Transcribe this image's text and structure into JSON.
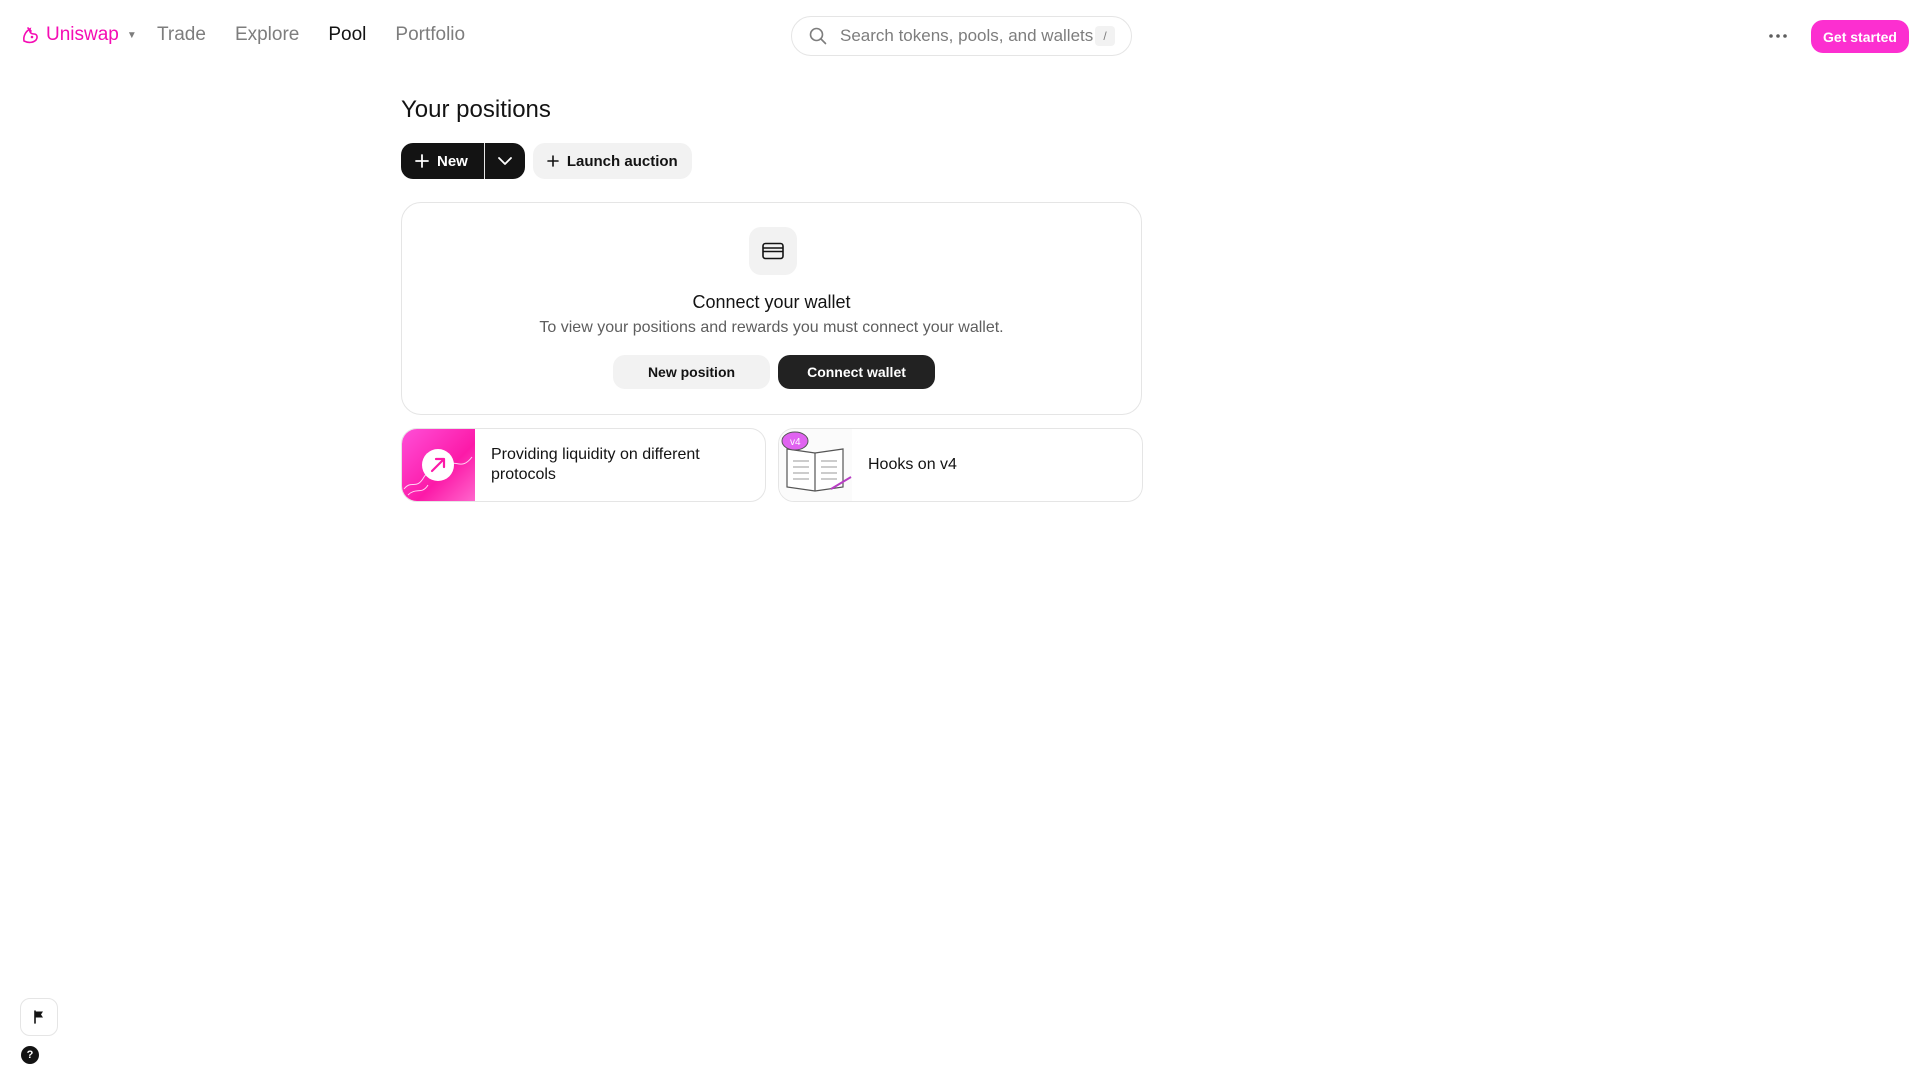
{
  "nav": {
    "brand": "Uniswap",
    "brand_icon": "uniswap-unicorn-icon",
    "links": [
      "Trade",
      "Explore",
      "Pool",
      "Portfolio"
    ],
    "active_link": "Pool",
    "search_placeholder": "Search tokens, pools, and wallets",
    "search_shortcut": "/",
    "more_icon": "more-horizontal-icon",
    "get_started_label": "Get started"
  },
  "main": {
    "title": "Your positions",
    "new_label": "New",
    "launch_auction_label": "Launch auction",
    "wallet_card": {
      "icon": "wallet-icon",
      "title": "Connect your wallet",
      "description": "To view your positions and rewards you must connect your wallet.",
      "new_position_label": "New position",
      "connect_wallet_label": "Connect wallet"
    },
    "learn_cards": [
      {
        "label": "Providing liquidity on different protocols",
        "thumb": "liquidity-arrow-thumb"
      },
      {
        "label": "Hooks on v4",
        "thumb": "v4-book-thumb",
        "badge": "v4"
      }
    ]
  },
  "footer": {
    "flag_icon": "flag-icon",
    "help_label": "?"
  },
  "colors": {
    "brand_pink": "#f50db4",
    "cta_pink": "#fc2fd0",
    "primary_dark": "#131313",
    "muted_text": "#7d7d7d",
    "surface": "#f2f2f2",
    "border": "#e5e5e5"
  }
}
